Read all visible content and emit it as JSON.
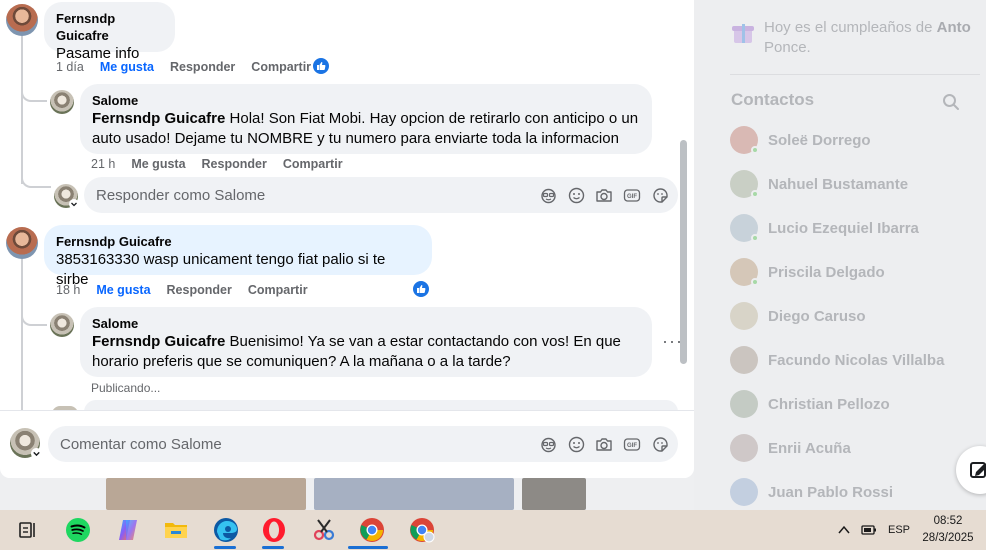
{
  "thread": {
    "comment1": {
      "author": "Fernsndp Guicafre",
      "text": "Pasame info",
      "time": "1 día",
      "like": "Me gusta",
      "reply": "Responder",
      "share": "Compartir"
    },
    "reply1": {
      "author": "Salome",
      "mention": "Fernsndp Guicafre",
      "text_line1": " Hola! Son Fiat Mobi. Hay opcion de retirarlo con anticipo o un",
      "text_line2": "auto usado! Dejame tu NOMBRE y tu numero para enviarte toda la informacion",
      "time": "21 h",
      "like": "Me gusta",
      "reply": "Responder",
      "share": "Compartir"
    },
    "reply_input": {
      "placeholder": "Responder como Salome"
    },
    "comment2": {
      "author": "Fernsndp Guicafre",
      "text": "3853163330 wasp unicament tengo fiat palio si te sirbe",
      "time": "18 h",
      "like": "Me gusta",
      "reply": "Responder",
      "share": "Compartir"
    },
    "reply2": {
      "author": "Salome",
      "mention": "Fernsndp Guicafre",
      "text_line1": " Buenisimo! Ya se van a estar contactando con vos! En que",
      "text_line2": "horario preferis que se comuniquen? A la mañana o a la tarde?",
      "status": "Publicando...",
      "more": "···"
    }
  },
  "composer": {
    "placeholder": "Comentar como Salome"
  },
  "input_tools": [
    "avatar-sticker-icon",
    "emoji-icon",
    "camera-icon",
    "gif-icon",
    "sticker-icon"
  ],
  "sidebar": {
    "birthday_prefix": "Hoy es el cumpleaños de ",
    "birthday_name": "Anto",
    "birthday_line2": "Ponce.",
    "contacts_title": "Contactos",
    "contacts": [
      {
        "name": "Soleë Dorrego",
        "online": true
      },
      {
        "name": "Nahuel Bustamante",
        "online": true
      },
      {
        "name": "Lucio Ezequiel Ibarra",
        "online": true
      },
      {
        "name": "Priscila Delgado",
        "online": true
      },
      {
        "name": "Diego Caruso",
        "online": false
      },
      {
        "name": "Facundo Nicolas Villalba",
        "online": false
      },
      {
        "name": "Christian Pellozo",
        "online": false
      },
      {
        "name": "Enrii Acuña",
        "online": false
      },
      {
        "name": "Juan Pablo Rossi",
        "online": false
      }
    ]
  },
  "taskbar": {
    "apps": [
      "task-view",
      "spotify",
      "copilot",
      "file-explorer",
      "edge",
      "opera",
      "snipping-tool",
      "chrome",
      "chrome-profile"
    ],
    "language": "ESP",
    "time": "08:52",
    "date": "28/3/2025"
  },
  "colors": {
    "accent": "#0866ff",
    "bubble": "#f0f2f5",
    "highlight_bubble": "#e7f3ff"
  }
}
